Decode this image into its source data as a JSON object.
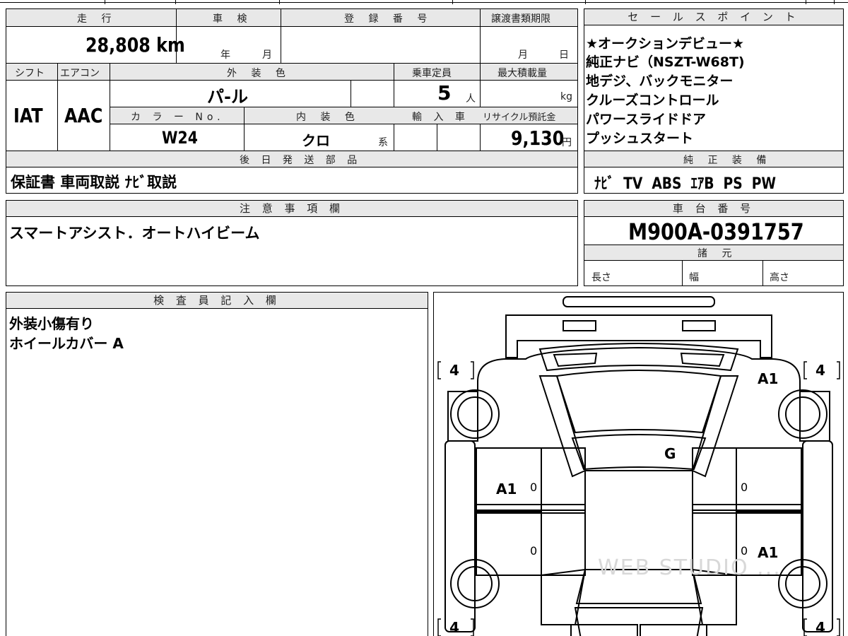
{
  "top_info": {
    "mileage_header": "走 行",
    "inspection_header": "車 検",
    "reg_number_header": "登 録 番 号",
    "transfer_doc_header": "譲渡書類期限",
    "mileage_value": "28,808 km",
    "inspection_year": "年",
    "inspection_month": "月",
    "transfer_month": "月",
    "transfer_day": "日",
    "shift_header": "シフト",
    "ac_header": "エアコン",
    "exterior_color_header": "外 装 色",
    "capacity_header": "乗車定員",
    "max_load_header": "最大積載量",
    "shift_value": "IAT",
    "ac_value": "AAC",
    "exterior_color_value": "パ-ル",
    "capacity_value": "5",
    "capacity_unit": "人",
    "max_load_unit": "kg",
    "color_no_header": "カ ラ ー No.",
    "interior_color_header": "内 装 色",
    "import_header": "輸 入 車",
    "recycle_header": "リサイクル預託金",
    "color_no_value": "W24",
    "interior_color_value": "クロ",
    "interior_color_suffix": "系",
    "recycle_value": "9,130",
    "recycle_unit": "円",
    "later_parts_header": "後 日 発 送 部 品",
    "later_parts_value": "保証書 車両取説 ﾅﾋﾞ取説"
  },
  "sales_points": {
    "header": "セ ー ル ス ポ イ ン ト",
    "items": [
      "★オークションデビュー★",
      "純正ナビ（NSZT-W68T)",
      "地デジ、バックモニター",
      "クルーズコントロール",
      "パワースライドドア",
      "プッシュスタート"
    ]
  },
  "genuine_equipment": {
    "header": "純 正 装 備",
    "value": "ﾅﾋﾞ  TV  ABS  ｴｱB  PS  PW"
  },
  "notes": {
    "header": "注 意 事 項 欄",
    "value": "スマートアシスト．オートハイビーム"
  },
  "chassis": {
    "header": "車 台 番 号",
    "value": "M900A-0391757",
    "specs_header": "諸 元",
    "length_label": "長さ",
    "width_label": "幅",
    "height_label": "高さ"
  },
  "inspector": {
    "header": "検 査 員 記 入 欄",
    "lines": [
      "外装小傷有り",
      "ホイールカバー A"
    ]
  },
  "diagram": {
    "tire_fl": "4",
    "tire_fr": "4",
    "tire_rl": "4",
    "tire_rr": "4",
    "mark_fr_fender": "A1",
    "mark_windshield": "G",
    "mark_front_left_door": "A1",
    "mark_rear_right_door": "A1",
    "door_zero_fl": "0",
    "door_zero_fr": "0",
    "door_zero_rl": "0",
    "door_zero_rr": "0",
    "watermark": "WEB STUDIO ..."
  }
}
